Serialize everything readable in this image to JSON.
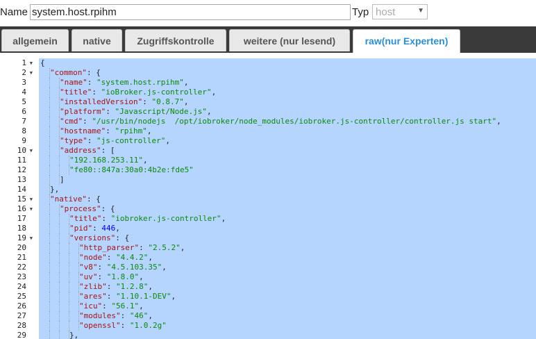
{
  "form": {
    "name_label": "Name",
    "name_value": "system.host.rpihm",
    "typ_label": "Typ",
    "typ_value": "host"
  },
  "tabs": [
    {
      "label": "allgemein",
      "active": false
    },
    {
      "label": "native",
      "active": false
    },
    {
      "label": "Zugriffskontrolle",
      "active": false
    },
    {
      "label": "weitere (nur lesend)",
      "active": false
    },
    {
      "label": "raw(nur Experten)",
      "active": true
    }
  ],
  "colors": {
    "active_tab": "#2a8fd6",
    "selection": "#b5d5ff",
    "json_key": "#a31515",
    "json_string": "#0a8a0a",
    "json_number": "#0000ff"
  },
  "editor": {
    "lines": [
      {
        "n": "1",
        "fold": true,
        "indent": 0,
        "parts": [
          [
            "p",
            "{"
          ]
        ]
      },
      {
        "n": "2",
        "fold": true,
        "indent": 1,
        "parts": [
          [
            "k",
            "\"common\""
          ],
          [
            "p",
            ": {"
          ]
        ]
      },
      {
        "n": "3",
        "fold": false,
        "indent": 2,
        "parts": [
          [
            "k",
            "\"name\""
          ],
          [
            "p",
            ": "
          ],
          [
            "s",
            "\"system.host.rpihm\""
          ],
          [
            "p",
            ","
          ]
        ]
      },
      {
        "n": "4",
        "fold": false,
        "indent": 2,
        "parts": [
          [
            "k",
            "\"title\""
          ],
          [
            "p",
            ": "
          ],
          [
            "s",
            "\"ioBroker.js-controller\""
          ],
          [
            "p",
            ","
          ]
        ]
      },
      {
        "n": "5",
        "fold": false,
        "indent": 2,
        "parts": [
          [
            "k",
            "\"installedVersion\""
          ],
          [
            "p",
            ": "
          ],
          [
            "s",
            "\"0.8.7\""
          ],
          [
            "p",
            ","
          ]
        ]
      },
      {
        "n": "6",
        "fold": false,
        "indent": 2,
        "parts": [
          [
            "k",
            "\"platform\""
          ],
          [
            "p",
            ": "
          ],
          [
            "s",
            "\"Javascript/Node.js\""
          ],
          [
            "p",
            ","
          ]
        ]
      },
      {
        "n": "7",
        "fold": false,
        "indent": 2,
        "parts": [
          [
            "k",
            "\"cmd\""
          ],
          [
            "p",
            ": "
          ],
          [
            "s",
            "\"/usr/bin/nodejs  /opt/iobroker/node_modules/iobroker.js-controller/controller.js start\""
          ],
          [
            "p",
            ","
          ]
        ]
      },
      {
        "n": "8",
        "fold": false,
        "indent": 2,
        "parts": [
          [
            "k",
            "\"hostname\""
          ],
          [
            "p",
            ": "
          ],
          [
            "s",
            "\"rpihm\""
          ],
          [
            "p",
            ","
          ]
        ]
      },
      {
        "n": "9",
        "fold": false,
        "indent": 2,
        "parts": [
          [
            "k",
            "\"type\""
          ],
          [
            "p",
            ": "
          ],
          [
            "s",
            "\"js-controller\""
          ],
          [
            "p",
            ","
          ]
        ]
      },
      {
        "n": "10",
        "fold": true,
        "indent": 2,
        "parts": [
          [
            "k",
            "\"address\""
          ],
          [
            "p",
            ": ["
          ]
        ]
      },
      {
        "n": "11",
        "fold": false,
        "indent": 3,
        "parts": [
          [
            "s",
            "\"192.168.253.11\""
          ],
          [
            "p",
            ","
          ]
        ]
      },
      {
        "n": "12",
        "fold": false,
        "indent": 3,
        "parts": [
          [
            "s",
            "\"fe80::847a:30a0:4b2e:fde5\""
          ]
        ]
      },
      {
        "n": "13",
        "fold": false,
        "indent": 2,
        "parts": [
          [
            "p",
            "]"
          ]
        ]
      },
      {
        "n": "14",
        "fold": false,
        "indent": 1,
        "parts": [
          [
            "p",
            "},"
          ]
        ]
      },
      {
        "n": "15",
        "fold": true,
        "indent": 1,
        "parts": [
          [
            "k",
            "\"native\""
          ],
          [
            "p",
            ": {"
          ]
        ]
      },
      {
        "n": "16",
        "fold": true,
        "indent": 2,
        "parts": [
          [
            "k",
            "\"process\""
          ],
          [
            "p",
            ": {"
          ]
        ]
      },
      {
        "n": "17",
        "fold": false,
        "indent": 3,
        "parts": [
          [
            "k",
            "\"title\""
          ],
          [
            "p",
            ": "
          ],
          [
            "s",
            "\"iobroker.js-controller\""
          ],
          [
            "p",
            ","
          ]
        ]
      },
      {
        "n": "18",
        "fold": false,
        "indent": 3,
        "parts": [
          [
            "k",
            "\"pid\""
          ],
          [
            "p",
            ": "
          ],
          [
            "n",
            "446"
          ],
          [
            "p",
            ","
          ]
        ]
      },
      {
        "n": "19",
        "fold": true,
        "indent": 3,
        "parts": [
          [
            "k",
            "\"versions\""
          ],
          [
            "p",
            ": {"
          ]
        ]
      },
      {
        "n": "20",
        "fold": false,
        "indent": 4,
        "parts": [
          [
            "k",
            "\"http_parser\""
          ],
          [
            "p",
            ": "
          ],
          [
            "s",
            "\"2.5.2\""
          ],
          [
            "p",
            ","
          ]
        ]
      },
      {
        "n": "21",
        "fold": false,
        "indent": 4,
        "parts": [
          [
            "k",
            "\"node\""
          ],
          [
            "p",
            ": "
          ],
          [
            "s",
            "\"4.4.2\""
          ],
          [
            "p",
            ","
          ]
        ]
      },
      {
        "n": "22",
        "fold": false,
        "indent": 4,
        "parts": [
          [
            "k",
            "\"v8\""
          ],
          [
            "p",
            ": "
          ],
          [
            "s",
            "\"4.5.103.35\""
          ],
          [
            "p",
            ","
          ]
        ]
      },
      {
        "n": "23",
        "fold": false,
        "indent": 4,
        "parts": [
          [
            "k",
            "\"uv\""
          ],
          [
            "p",
            ": "
          ],
          [
            "s",
            "\"1.8.0\""
          ],
          [
            "p",
            ","
          ]
        ]
      },
      {
        "n": "24",
        "fold": false,
        "indent": 4,
        "parts": [
          [
            "k",
            "\"zlib\""
          ],
          [
            "p",
            ": "
          ],
          [
            "s",
            "\"1.2.8\""
          ],
          [
            "p",
            ","
          ]
        ]
      },
      {
        "n": "25",
        "fold": false,
        "indent": 4,
        "parts": [
          [
            "k",
            "\"ares\""
          ],
          [
            "p",
            ": "
          ],
          [
            "s",
            "\"1.10.1-DEV\""
          ],
          [
            "p",
            ","
          ]
        ]
      },
      {
        "n": "26",
        "fold": false,
        "indent": 4,
        "parts": [
          [
            "k",
            "\"icu\""
          ],
          [
            "p",
            ": "
          ],
          [
            "s",
            "\"56.1\""
          ],
          [
            "p",
            ","
          ]
        ]
      },
      {
        "n": "27",
        "fold": false,
        "indent": 4,
        "parts": [
          [
            "k",
            "\"modules\""
          ],
          [
            "p",
            ": "
          ],
          [
            "s",
            "\"46\""
          ],
          [
            "p",
            ","
          ]
        ]
      },
      {
        "n": "28",
        "fold": false,
        "indent": 4,
        "parts": [
          [
            "k",
            "\"openssl\""
          ],
          [
            "p",
            ": "
          ],
          [
            "s",
            "\"1.0.2g\""
          ]
        ]
      },
      {
        "n": "29",
        "fold": false,
        "indent": 3,
        "parts": [
          [
            "p",
            "},"
          ]
        ]
      }
    ]
  }
}
